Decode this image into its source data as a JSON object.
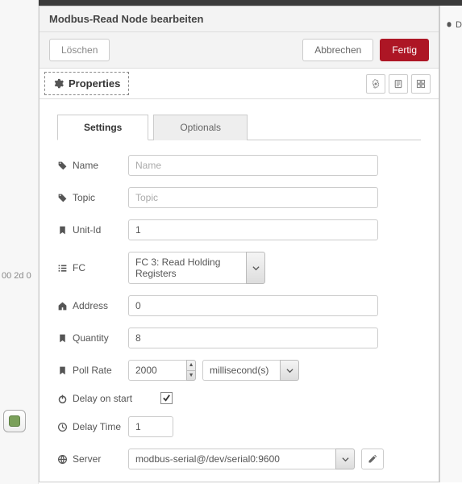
{
  "backdrop": {
    "time_label": "00 2d 0"
  },
  "header": {
    "title": "Modbus-Read Node bearbeiten"
  },
  "actions": {
    "delete_label": "Löschen",
    "cancel_label": "Abbrechen",
    "done_label": "Fertig"
  },
  "tabs": {
    "properties_label": "Properties"
  },
  "subtabs": {
    "settings_label": "Settings",
    "optionals_label": "Optionals"
  },
  "form": {
    "name": {
      "label": "Name",
      "placeholder": "Name",
      "value": ""
    },
    "topic": {
      "label": "Topic",
      "placeholder": "Topic",
      "value": ""
    },
    "unit_id": {
      "label": "Unit-Id",
      "value": "1"
    },
    "fc": {
      "label": "FC",
      "selected": "FC 3: Read Holding Registers"
    },
    "address": {
      "label": "Address",
      "value": "0"
    },
    "quantity": {
      "label": "Quantity",
      "value": "8"
    },
    "poll_rate": {
      "label": "Poll Rate",
      "value": "2000",
      "unit": "millisecond(s)"
    },
    "delay_on_start": {
      "label": "Delay on start",
      "checked": true
    },
    "delay_time": {
      "label": "Delay Time",
      "value": "1"
    },
    "server": {
      "label": "Server",
      "selected": "modbus-serial@/dev/serial0:9600"
    }
  },
  "right_panel": {
    "label": "D"
  }
}
